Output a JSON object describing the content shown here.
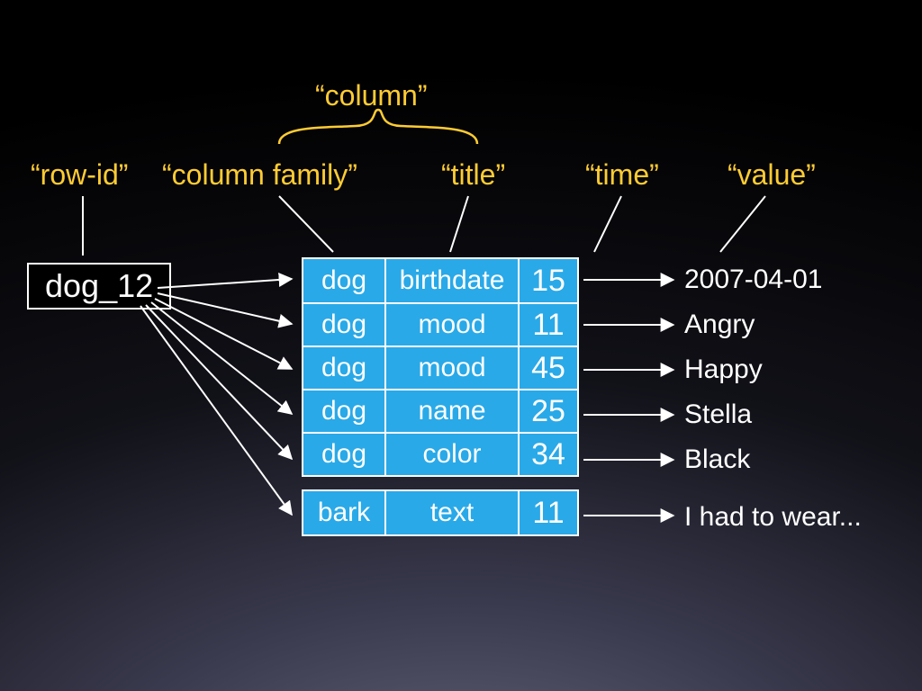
{
  "labels": {
    "column": "“column”",
    "row_id": "“row-id”",
    "column_family": "“column family”",
    "title": "“title”",
    "time": "“time”",
    "value": "“value”"
  },
  "row_id": "dog_12",
  "groups": [
    {
      "rows": [
        {
          "family": "dog",
          "title": "birthdate",
          "time": "15",
          "value": "2007-04-01"
        },
        {
          "family": "dog",
          "title": "mood",
          "time": "11",
          "value": "Angry"
        },
        {
          "family": "dog",
          "title": "mood",
          "time": "45",
          "value": "Happy"
        },
        {
          "family": "dog",
          "title": "name",
          "time": "25",
          "value": "Stella"
        },
        {
          "family": "dog",
          "title": "color",
          "time": "34",
          "value": "Black"
        }
      ]
    },
    {
      "rows": [
        {
          "family": "bark",
          "title": "text",
          "time": "11",
          "value": "I had to wear..."
        }
      ]
    }
  ]
}
